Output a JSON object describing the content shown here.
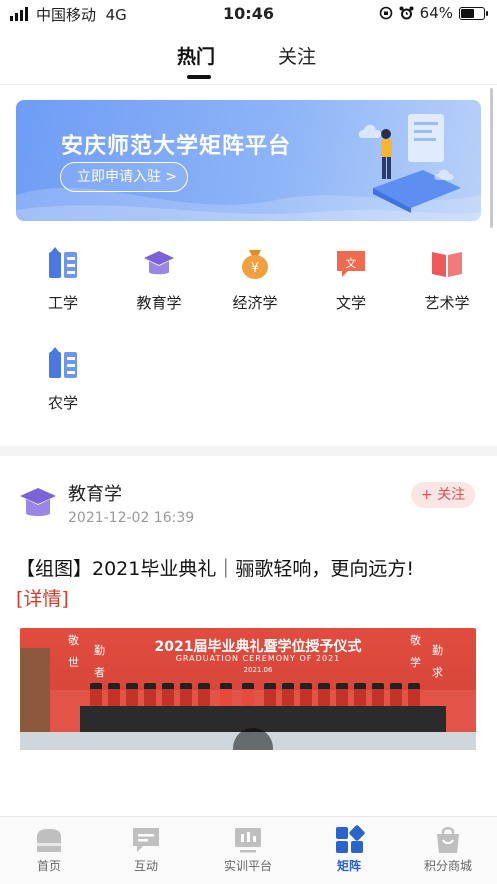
{
  "status_bar": {
    "carrier": "中国移动",
    "network": "4G",
    "time": "10:46",
    "battery_percent": "64%",
    "battery_level": 0.64
  },
  "tabs": [
    {
      "label": "热门",
      "active": true
    },
    {
      "label": "关注",
      "active": false
    }
  ],
  "banner": {
    "title": "安庆师范大学矩阵平台",
    "button_label": "立即申请入驻",
    "button_chevron": ">"
  },
  "categories": [
    {
      "label": "工学",
      "icon": "engineering-icon",
      "color": "#4a78e0"
    },
    {
      "label": "教育学",
      "icon": "graduation-cap-icon",
      "color": "#7b62d9"
    },
    {
      "label": "经济学",
      "icon": "money-bag-icon",
      "color": "#f0a13e"
    },
    {
      "label": "文学",
      "icon": "speech-bubble-icon",
      "color": "#ef6a4e",
      "glyph": "文"
    },
    {
      "label": "艺术学",
      "icon": "art-book-icon",
      "color": "#ee5a5a"
    },
    {
      "label": "农学",
      "icon": "agriculture-icon",
      "color": "#4a78e0"
    }
  ],
  "post": {
    "author": "教育学",
    "timestamp": "2021-12-02 16:39",
    "follow_label": "+ 关注",
    "title": "【组图】2021毕业典礼｜骊歌轻响，更向远方!",
    "detail_link": "[详情]",
    "image": {
      "heading": "2021届毕业典礼暨学位授予仪式",
      "subheading": "GRADUATION CEREMONY OF 2021",
      "date": "2021.06",
      "side_chars_left": [
        "敬",
        "勤",
        "世",
        "者"
      ],
      "side_chars_right": [
        "敬",
        "勤",
        "学",
        "求"
      ]
    }
  },
  "bottom_nav": [
    {
      "label": "首页",
      "icon": "home-icon",
      "active": false
    },
    {
      "label": "互动",
      "icon": "chat-icon",
      "active": false
    },
    {
      "label": "实训平台",
      "icon": "training-icon",
      "active": false
    },
    {
      "label": "矩阵",
      "icon": "matrix-icon",
      "active": true
    },
    {
      "label": "积分商城",
      "icon": "shopping-bag-icon",
      "active": false
    }
  ],
  "colors": {
    "accent_blue": "#2a63c9",
    "follow_red": "#e05050",
    "link_red": "#d23c2c",
    "banner_blue": "#6f9cf5"
  }
}
